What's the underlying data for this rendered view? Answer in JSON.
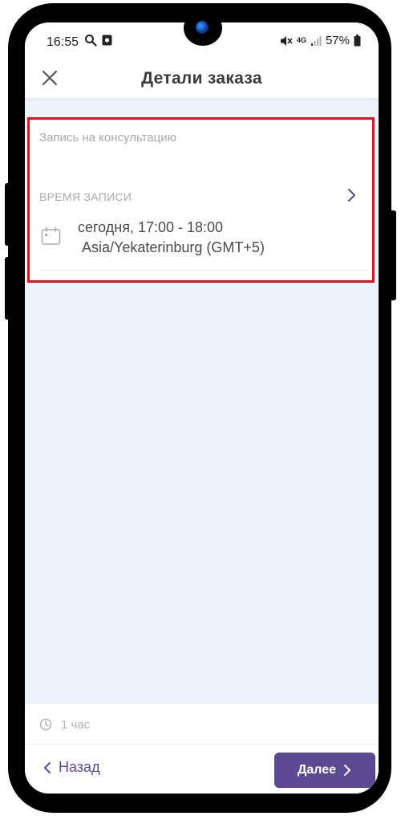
{
  "status_bar": {
    "time": "16:55",
    "battery": "57%",
    "network": "4G"
  },
  "header": {
    "title": "Детали заказа"
  },
  "booking": {
    "service_title": "Запись на консультацию",
    "section_label": "ВРЕМЯ ЗАПИСИ",
    "time_range": "сегодня, 17:00 - 18:00",
    "timezone": "Asia/Yekaterinburg (GMT+5)"
  },
  "summary": {
    "duration": "1 час"
  },
  "navigation": {
    "back_label": "Назад",
    "next_label": "Далее"
  },
  "colors": {
    "accent": "#5b4a92",
    "highlight_border": "#e0121e",
    "background": "#eef2fb"
  },
  "icons": [
    "close-icon",
    "chevron-right-icon",
    "calendar-icon",
    "clock-icon",
    "chevron-left-icon",
    "search-icon",
    "camera-icon",
    "mute-icon",
    "signal-icon",
    "battery-icon"
  ]
}
